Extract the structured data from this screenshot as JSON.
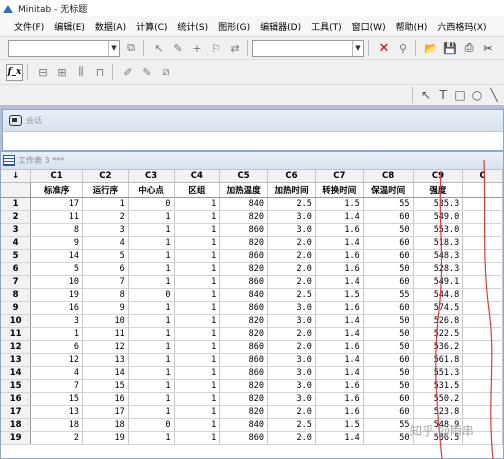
{
  "window": {
    "title": "Minitab - 无标题"
  },
  "menu": [
    "文件(F)",
    "编辑(E)",
    "数据(A)",
    "计算(C)",
    "统计(S)",
    "图形(G)",
    "编辑器(D)",
    "工具(T)",
    "窗口(W)",
    "帮助(H)",
    "六西格玛(X)"
  ],
  "toolbar1": {
    "combo1_value": "",
    "combo2_value": ""
  },
  "toolbar2": {
    "fx_label": "f_x"
  },
  "session": {
    "title": "会话"
  },
  "worksheet": {
    "title": "工作表 3 ***",
    "corner": "↓",
    "columns": [
      {
        "id": "C1",
        "name": "标准序"
      },
      {
        "id": "C2",
        "name": "运行序"
      },
      {
        "id": "C3",
        "name": "中心点"
      },
      {
        "id": "C4",
        "name": "区组"
      },
      {
        "id": "C5",
        "name": "加热温度"
      },
      {
        "id": "C6",
        "name": "加热时间"
      },
      {
        "id": "C7",
        "name": "转换时间"
      },
      {
        "id": "C8",
        "name": "保温时间"
      },
      {
        "id": "C9",
        "name": "强度"
      },
      {
        "id": "C",
        "name": ""
      }
    ],
    "rows": [
      [
        "1",
        "17",
        "1",
        "0",
        "1",
        "840",
        "2.5",
        "1.5",
        "55",
        "535.3"
      ],
      [
        "2",
        "11",
        "2",
        "1",
        "1",
        "820",
        "3.0",
        "1.4",
        "60",
        "549.0"
      ],
      [
        "3",
        "8",
        "3",
        "1",
        "1",
        "860",
        "3.0",
        "1.6",
        "50",
        "553.0"
      ],
      [
        "4",
        "9",
        "4",
        "1",
        "1",
        "820",
        "2.0",
        "1.4",
        "60",
        "518.3"
      ],
      [
        "5",
        "14",
        "5",
        "1",
        "1",
        "860",
        "2.0",
        "1.6",
        "60",
        "548.3"
      ],
      [
        "6",
        "5",
        "6",
        "1",
        "1",
        "820",
        "2.0",
        "1.6",
        "50",
        "528.3"
      ],
      [
        "7",
        "10",
        "7",
        "1",
        "1",
        "860",
        "2.0",
        "1.4",
        "60",
        "549.1"
      ],
      [
        "8",
        "19",
        "8",
        "0",
        "1",
        "840",
        "2.5",
        "1.5",
        "55",
        "544.8"
      ],
      [
        "9",
        "16",
        "9",
        "1",
        "1",
        "860",
        "3.0",
        "1.6",
        "60",
        "574.5"
      ],
      [
        "10",
        "3",
        "10",
        "1",
        "1",
        "820",
        "3.0",
        "1.4",
        "50",
        "526.8"
      ],
      [
        "11",
        "1",
        "11",
        "1",
        "1",
        "820",
        "2.0",
        "1.4",
        "50",
        "522.5"
      ],
      [
        "12",
        "6",
        "12",
        "1",
        "1",
        "860",
        "2.0",
        "1.6",
        "50",
        "536.2"
      ],
      [
        "13",
        "12",
        "13",
        "1",
        "1",
        "860",
        "3.0",
        "1.4",
        "60",
        "561.8"
      ],
      [
        "14",
        "4",
        "14",
        "1",
        "1",
        "860",
        "3.0",
        "1.4",
        "50",
        "551.3"
      ],
      [
        "15",
        "7",
        "15",
        "1",
        "1",
        "820",
        "3.0",
        "1.6",
        "50",
        "531.5"
      ],
      [
        "16",
        "15",
        "16",
        "1",
        "1",
        "820",
        "3.0",
        "1.6",
        "60",
        "550.2"
      ],
      [
        "17",
        "13",
        "17",
        "1",
        "1",
        "820",
        "2.0",
        "1.6",
        "60",
        "523.8"
      ],
      [
        "18",
        "18",
        "18",
        "0",
        "1",
        "840",
        "2.5",
        "1.5",
        "55",
        "548.9"
      ],
      [
        "19",
        "2",
        "19",
        "1",
        "1",
        "860",
        "2.0",
        "1.4",
        "50",
        "536.5"
      ]
    ]
  },
  "watermark": "知乎 @雨串"
}
